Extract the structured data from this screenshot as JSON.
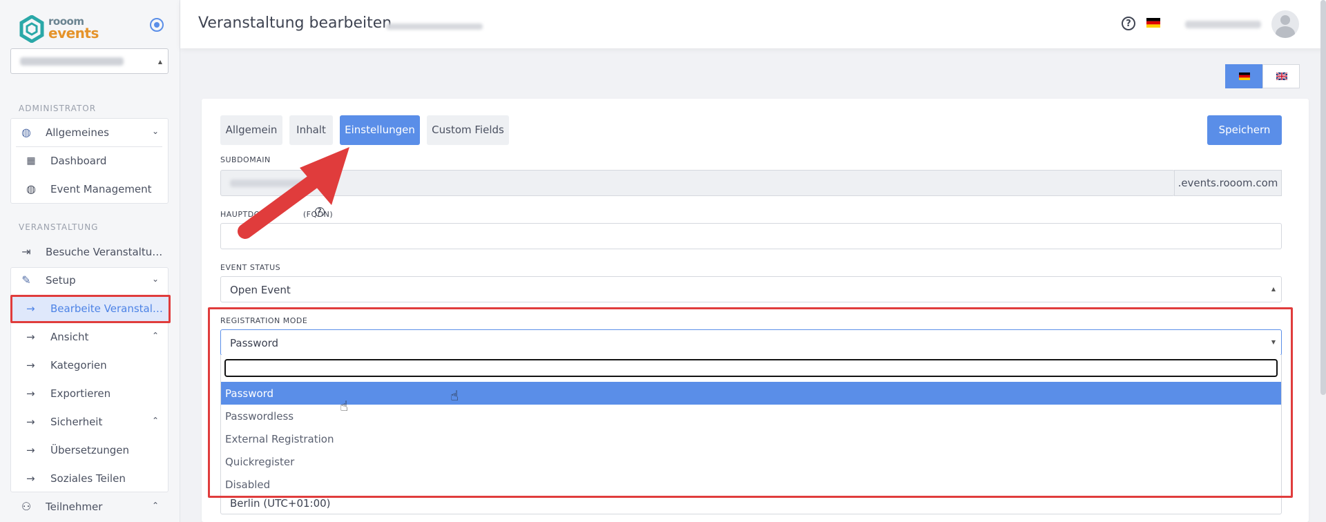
{
  "sidebar": {
    "logo_top": "rooom",
    "logo_bottom": "events",
    "section_admin": "ADMINISTRATOR",
    "section_event": "VERANSTALTUNG",
    "items": {
      "allgemeines": "Allgemeines",
      "dashboard": "Dashboard",
      "event_management": "Event Management",
      "besuche": "Besuche Veranstaltu…",
      "setup": "Setup",
      "bearbeite": "Bearbeite Veranstal…",
      "ansicht": "Ansicht",
      "kategorien": "Kategorien",
      "exportieren": "Exportieren",
      "sicherheit": "Sicherheit",
      "uebersetzungen": "Übersetzungen",
      "soziales": "Soziales Teilen",
      "teilnehmer": "Teilnehmer"
    }
  },
  "header": {
    "title": "Veranstaltung bearbeiten"
  },
  "tabs": {
    "allgemein": "Allgemein",
    "inhalt": "Inhalt",
    "einstellungen": "Einstellungen",
    "custom_fields": "Custom Fields"
  },
  "save_label": "Speichern",
  "fields": {
    "subdomain_label": "SUBDOMAIN",
    "subdomain_suffix": ".events.rooom.com",
    "hauptdomain_label_a": "HAUPTDO",
    "hauptdomain_label_b": "(FQDN)",
    "event_status_label": "EVENT STATUS",
    "event_status_value": "Open Event",
    "registration_mode_label": "REGISTRATION MODE",
    "registration_mode_value": "Password",
    "timezone_value": "Berlin (UTC+01:00)"
  },
  "dropdown": {
    "options": [
      "Password",
      "Passwordless",
      "External Registration",
      "Quickregister",
      "Disabled"
    ],
    "highlighted": "Password"
  },
  "colors": {
    "accent": "#5a8ee8",
    "annotation_red": "#e03c3c"
  }
}
